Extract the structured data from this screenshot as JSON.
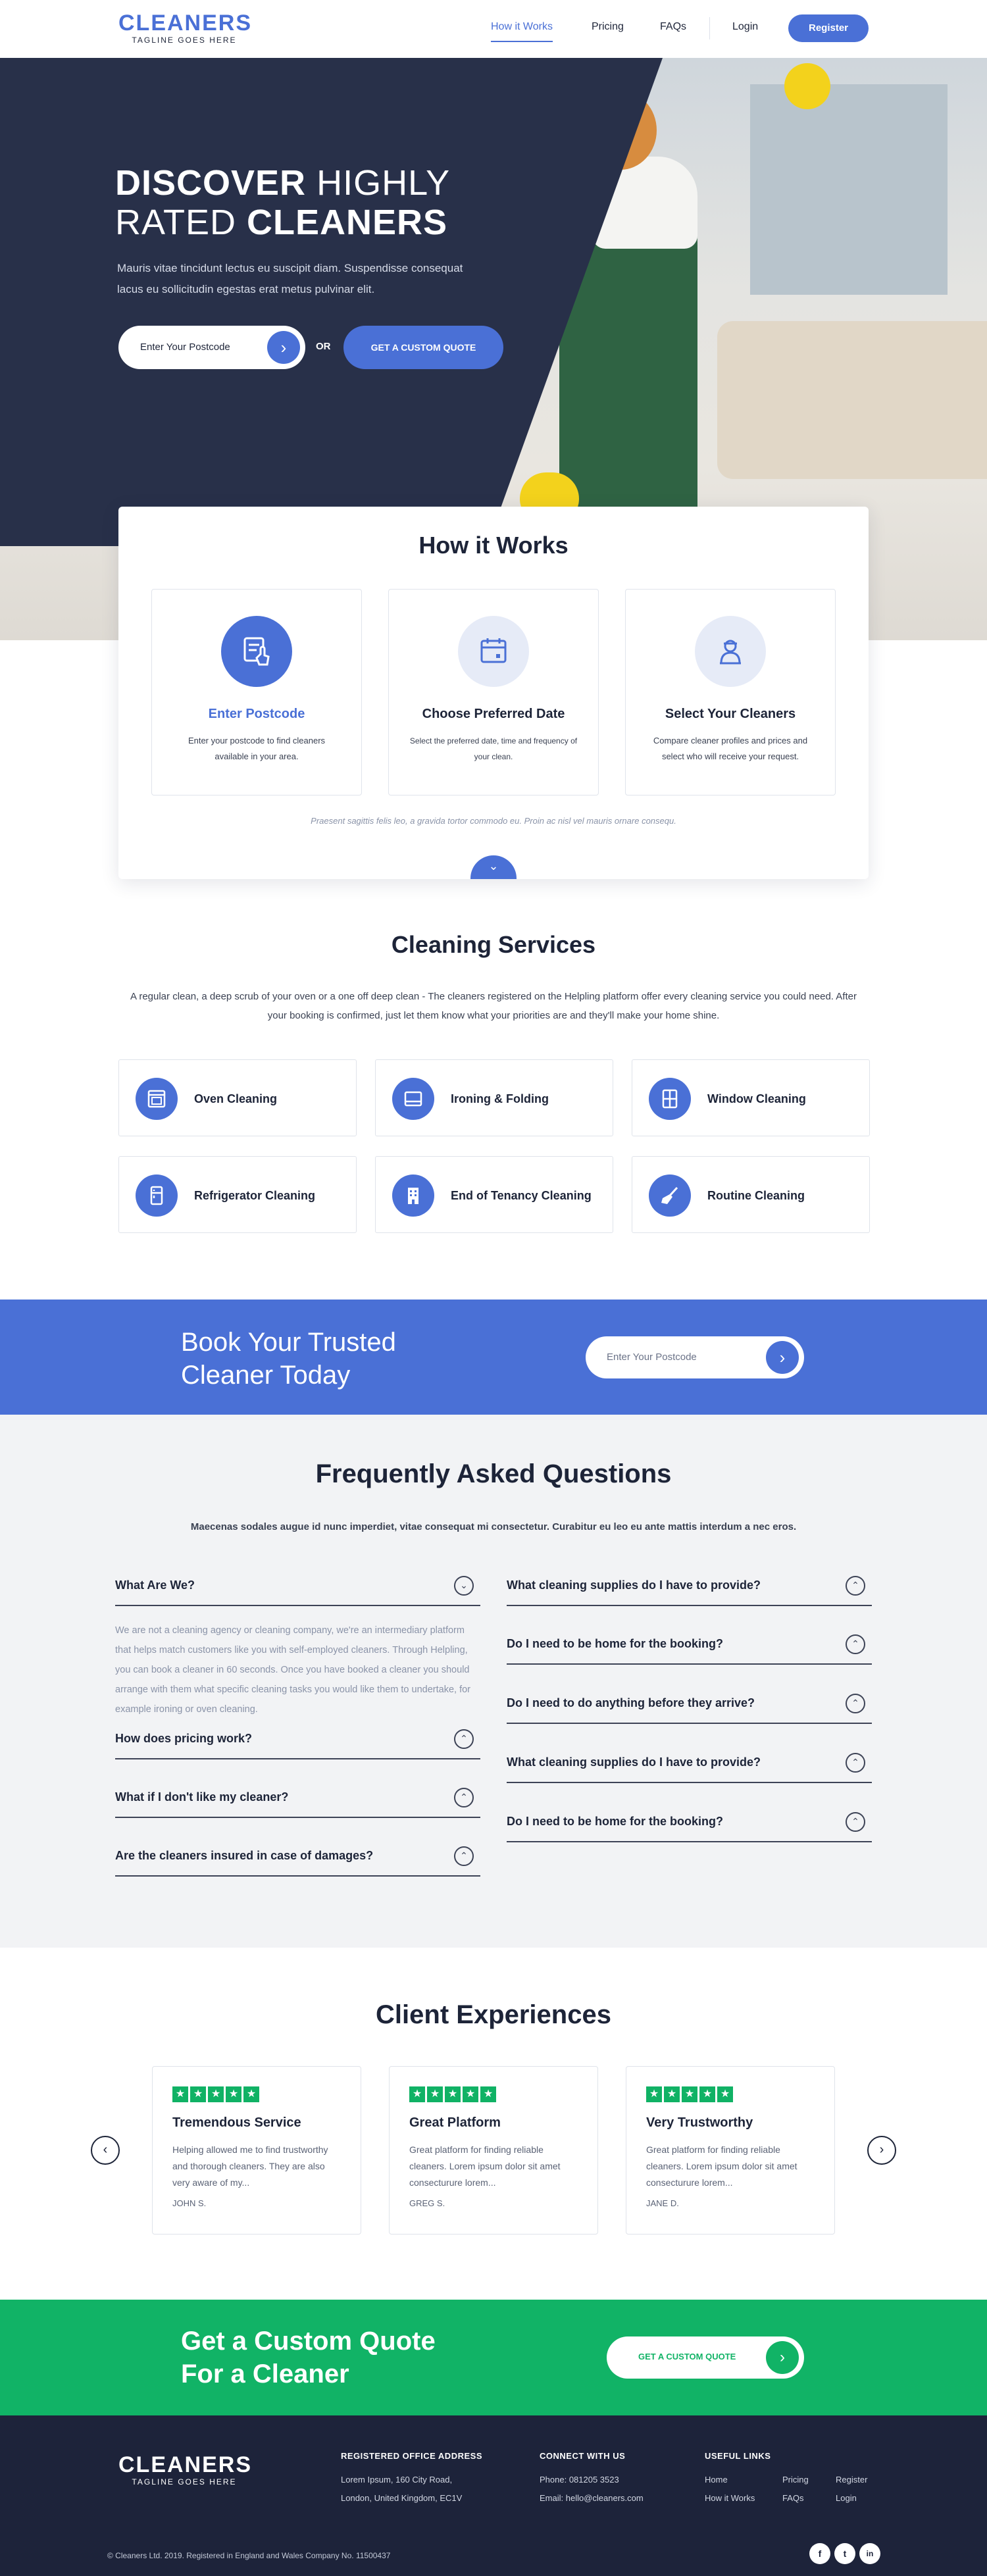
{
  "header": {
    "logo": "CLEANERS",
    "tagline": "TAGLINE GOES HERE",
    "nav": [
      "How it Works",
      "Pricing",
      "FAQs",
      "Login"
    ],
    "register": "Register"
  },
  "hero": {
    "title_w1": "DISCOVER",
    "title_w2": "HIGHLY",
    "title_w3": "RATED",
    "title_w4": "CLEANERS",
    "text": "Mauris vitae tincidunt lectus eu suscipit diam. Suspendisse consequat lacus eu sollicitudin egestas erat metus pulvinar elit.",
    "postcode_placeholder": "Enter Your Postcode",
    "or": "OR",
    "quote_button": "GET A CUSTOM QUOTE"
  },
  "how": {
    "title": "How it Works",
    "steps": [
      {
        "title": "Enter Postcode",
        "text": "Enter your postcode to find cleaners available in your area.",
        "icon": "touch-form-icon"
      },
      {
        "title": "Choose Preferred Date",
        "text": "Select the preferred date, time and frequency of your clean.",
        "icon": "calendar-icon"
      },
      {
        "title": "Select Your Cleaners",
        "text": "Compare cleaner profiles and prices and select who will receive your request.",
        "icon": "cleaner-person-icon"
      }
    ],
    "note": "Praesent sagittis felis leo, a gravida tortor commodo eu. Proin ac nisl vel mauris ornare consequ."
  },
  "services": {
    "title": "Cleaning Services",
    "intro": "A regular clean, a deep scrub of your oven or a one off deep clean - The cleaners registered on the Helpling platform offer every cleaning service you could need. After your booking is confirmed, just let them know what your priorities are and they'll make your home shine.",
    "items": [
      {
        "label": "Oven Cleaning",
        "icon": "oven-icon"
      },
      {
        "label": "Ironing & Folding",
        "icon": "iron-icon"
      },
      {
        "label": "Window Cleaning",
        "icon": "window-icon"
      },
      {
        "label": "Refrigerator Cleaning",
        "icon": "refrigerator-icon"
      },
      {
        "label": "End of Tenancy Cleaning",
        "icon": "building-icon"
      },
      {
        "label": "Routine Cleaning",
        "icon": "broom-icon"
      }
    ]
  },
  "book": {
    "line1": "Book Your Trusted",
    "line2": "Cleaner Today",
    "placeholder": "Enter Your Postcode"
  },
  "faq": {
    "title": "Frequently Asked Questions",
    "subtitle": "Maecenas sodales augue id nunc imperdiet, vitae consequat mi consectetur. Curabitur eu leo eu ante mattis interdum a nec eros.",
    "left": [
      "What Are We?",
      "How does pricing work?",
      "What if I don't like my cleaner?",
      "Are the cleaners insured in case of damages?"
    ],
    "answer": "We are not a cleaning agency or cleaning company, we're an intermediary platform that helps match customers like you with self-employed cleaners. Through Helpling, you can book a cleaner in 60 seconds. Once you have booked a cleaner you should arrange with them what specific cleaning tasks you would like them to undertake, for example ironing or oven cleaning.",
    "right": [
      "What cleaning supplies do I have to provide?",
      "Do I need to be home for the booking?",
      "Do I need to do anything before they arrive?",
      "What cleaning supplies do I have to provide?",
      "Do I need to be home for the booking?"
    ]
  },
  "testimonials": {
    "title": "Client Experiences",
    "items": [
      {
        "title": "Tremendous Service",
        "text": "Helping allowed me to find trustworthy and thorough cleaners. They are also very aware of my...",
        "author": "JOHN S.",
        "rating": 5
      },
      {
        "title": "Great Platform",
        "text": "Great platform for finding reliable cleaners. Lorem ipsum dolor sit amet consecturure lorem...",
        "author": "GREG S.",
        "rating": 5
      },
      {
        "title": "Very Trustworthy",
        "text": "Great platform for finding reliable cleaners. Lorem ipsum dolor sit amet consecturure lorem...",
        "author": "JANE D.",
        "rating": 5
      }
    ]
  },
  "quote": {
    "line1": "Get a Custom Quote",
    "line2": "For a Cleaner",
    "button": "GET A CUSTOM QUOTE"
  },
  "footer": {
    "logo": "CLEANERS",
    "tagline": "TAGLINE GOES HERE",
    "office_title": "REGISTERED OFFICE ADDRESS",
    "address1": "Lorem Ipsum, 160 City Road,",
    "address2": "London, United Kingdom, EC1V",
    "connect_title": "CONNECT WITH US",
    "phone": "Phone: 081205 3523",
    "email": "Email: hello@cleaners.com",
    "links_title": "USEFUL LINKS",
    "links": [
      "Home",
      "Pricing",
      "Register",
      "How it Works",
      "FAQs",
      "Login"
    ],
    "copyright": "© Cleaners Ltd. 2019. Registered in England and Wales Company No. 11500437",
    "social": [
      "f",
      "t",
      "in"
    ]
  },
  "colors": {
    "primary": "#4a70d6",
    "dark": "#283049",
    "green": "#11b366",
    "footer": "#1d233a"
  }
}
